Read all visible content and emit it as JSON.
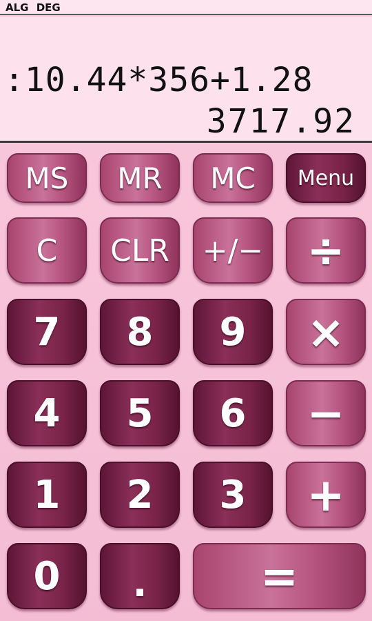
{
  "status": {
    "mode": "ALG",
    "angle": "DEG"
  },
  "display": {
    "expression": ":10.44*356+1.28",
    "result": "3717.92"
  },
  "keys": {
    "ms": "MS",
    "mr": "MR",
    "mc": "MC",
    "menu": "Menu",
    "c": "C",
    "clr": "CLR",
    "sign": "+/−",
    "divide": "÷",
    "k7": "7",
    "k8": "8",
    "k9": "9",
    "multiply": "×",
    "k4": "4",
    "k5": "5",
    "k6": "6",
    "minus": "−",
    "k1": "1",
    "k2": "2",
    "k3": "3",
    "plus": "+",
    "k0": "0",
    "dot": ".",
    "equals": "="
  },
  "colors": {
    "background": "#f7c9dd",
    "display_bg": "#fde1ec",
    "key_light": "#b55580",
    "key_dark": "#7a2449"
  }
}
